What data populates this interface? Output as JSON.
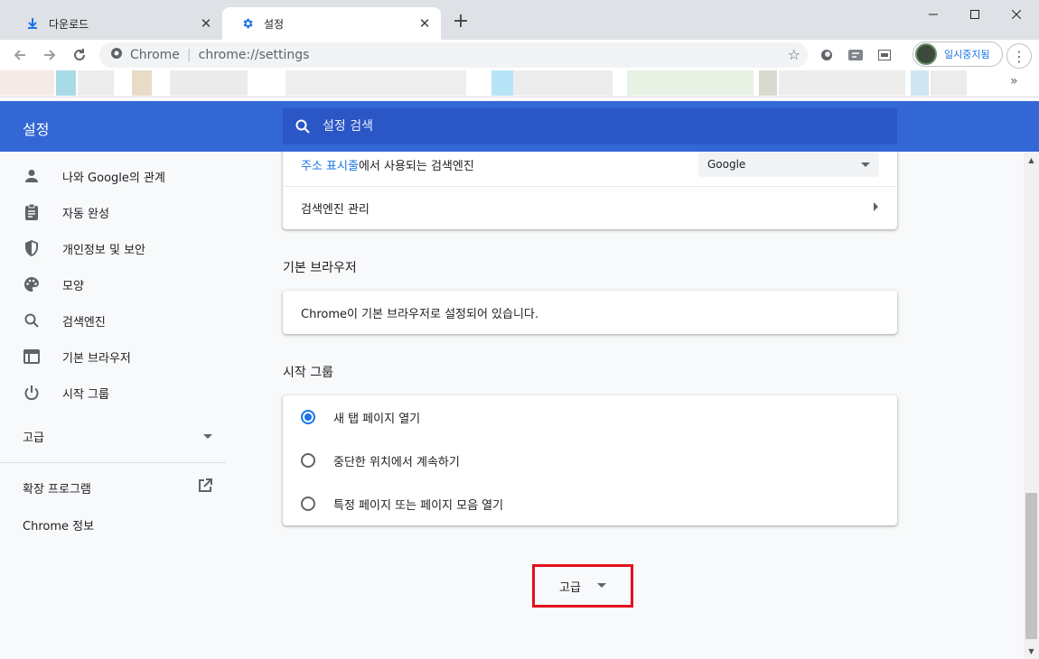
{
  "window": {
    "tabs": [
      {
        "label": "다운로드",
        "icon": "download-icon",
        "active": false
      },
      {
        "label": "설정",
        "icon": "gear-icon",
        "active": true
      }
    ],
    "new_tab": "+",
    "controls": {
      "minimize": "─",
      "maximize": "☐",
      "close": "✕"
    }
  },
  "toolbar": {
    "site_name": "Chrome",
    "url": "chrome://settings",
    "profile_label": "일시중지됨"
  },
  "header": {
    "title": "설정",
    "search_placeholder": "설정 검색"
  },
  "sidebar": {
    "items": [
      {
        "label": "나와 Google의 관계",
        "icon": "person-icon"
      },
      {
        "label": "자동 완성",
        "icon": "clipboard-icon"
      },
      {
        "label": "개인정보 및 보안",
        "icon": "shield-icon"
      },
      {
        "label": "모양",
        "icon": "palette-icon"
      },
      {
        "label": "검색엔진",
        "icon": "search-icon"
      },
      {
        "label": "기본 브라우저",
        "icon": "browser-icon"
      },
      {
        "label": "시작 그룹",
        "icon": "power-icon"
      }
    ],
    "advanced": "고급",
    "extensions": "확장 프로그램",
    "about": "Chrome 정보"
  },
  "search_engine": {
    "address_bar_link": "주소 표시줄",
    "address_bar_rest": "에서 사용되는 검색엔진",
    "selected_engine": "Google",
    "manage": "검색엔진 관리"
  },
  "default_browser": {
    "title": "기본 브라우저",
    "status": "Chrome이 기본 브라우저로 설정되어 있습니다."
  },
  "startup": {
    "title": "시작 그룹",
    "options": [
      {
        "label": "새 탭 페이지 열기",
        "checked": true
      },
      {
        "label": "중단한 위치에서 계속하기",
        "checked": false
      },
      {
        "label": "특정 페이지 또는 페이지 모음 열기",
        "checked": false
      }
    ]
  },
  "advanced_button": "고급",
  "colors": {
    "header_blue": "#3367d6",
    "accent_blue": "#1a73e8",
    "highlight_red": "#e3101d"
  }
}
